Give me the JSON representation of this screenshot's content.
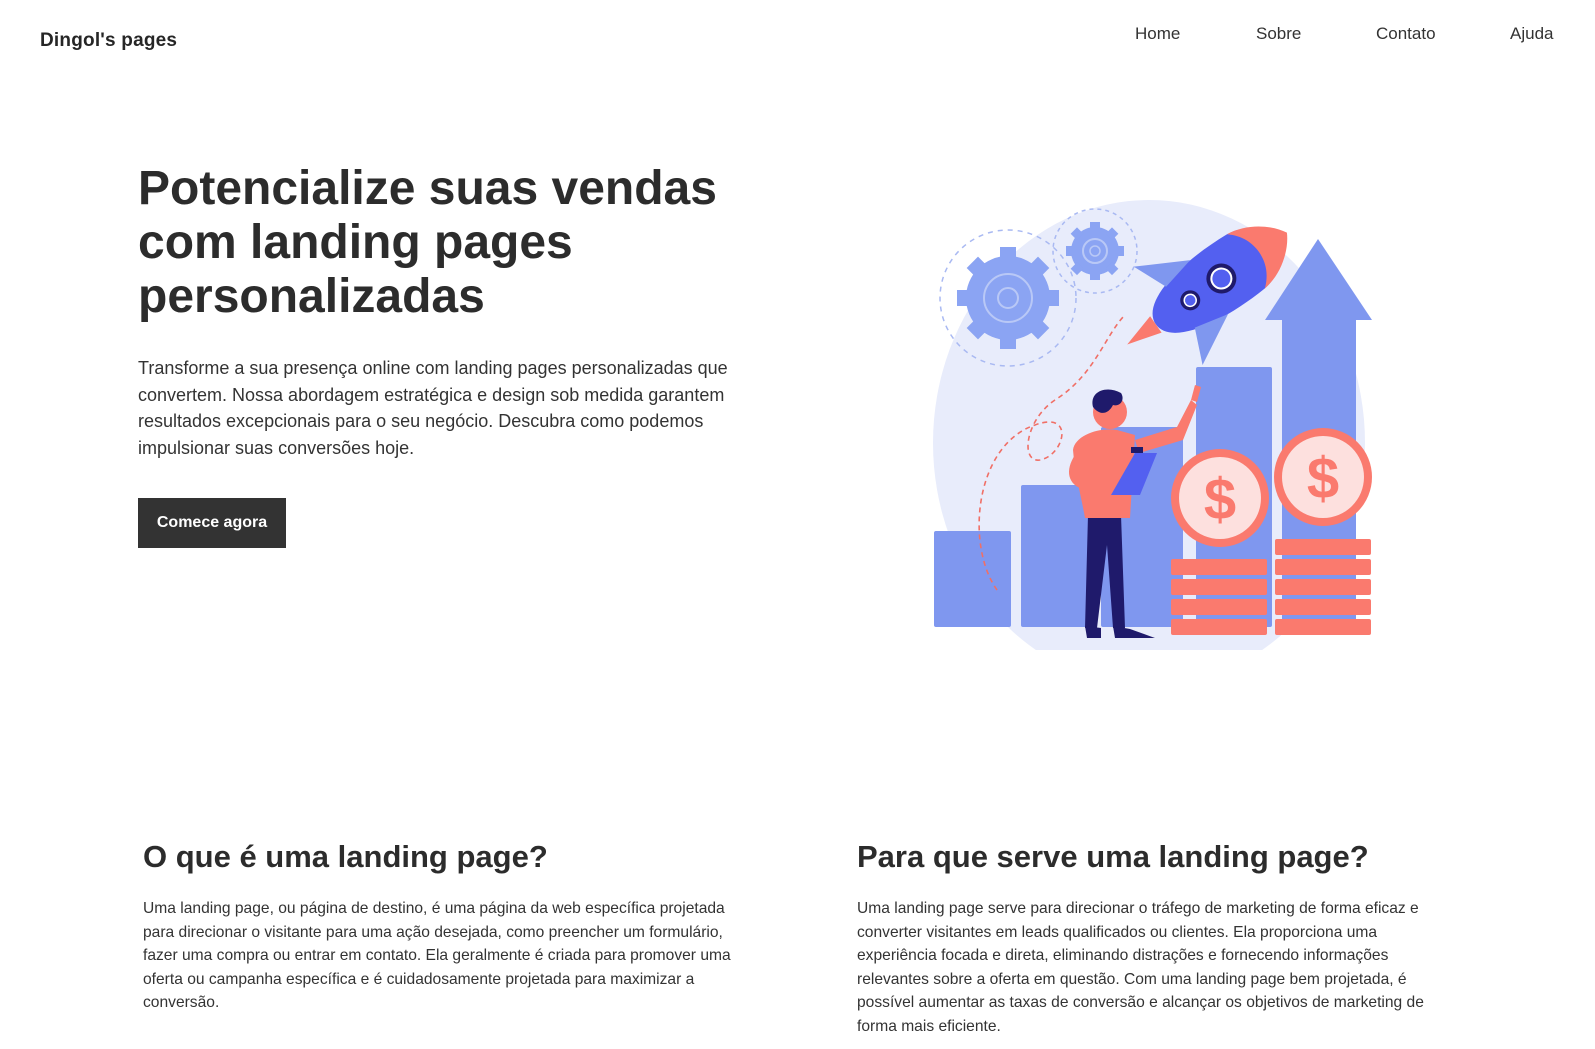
{
  "header": {
    "brand": "Dingol's pages",
    "nav": [
      "Home",
      "Sobre",
      "Contato",
      "Ajuda"
    ]
  },
  "hero": {
    "title": "Potencialize suas vendas com landing pages personalizadas",
    "text": "Transforme a sua presença online com landing pages personalizadas que convertem. Nossa abordagem estratégica e design sob medida garantem resultados excepcionais para o seu negócio. Descubra como podemos impulsionar suas conversões hoje.",
    "cta": "Comece agora",
    "illustration_icons": [
      "rocket-icon",
      "gear-icon",
      "dollar-coin-icon",
      "growth-arrow-icon",
      "person-clipboard-icon"
    ]
  },
  "sections": [
    {
      "title": "O que é uma landing page?",
      "text": "Uma landing page, ou página de destino, é uma página da web específica projetada para direcionar o visitante para uma ação desejada, como preencher um formulário, fazer uma compra ou entrar em contato. Ela geralmente é criada para promover uma oferta ou campanha específica e é cuidadosamente projetada para maximizar a conversão."
    },
    {
      "title": "Para que serve uma landing page?",
      "text": "Uma landing page serve para direcionar o tráfego de marketing de forma eficaz e converter visitantes em leads qualificados ou clientes. Ela proporciona uma experiência focada e direta, eliminando distrações e fornecendo informações relevantes sobre a oferta em questão. Com uma landing page bem projetada, é possível aumentar as taxas de conversão e alcançar os objetivos de marketing de forma mais eficiente."
    }
  ],
  "colors": {
    "text": "#2f2f2f",
    "button_bg": "#333333",
    "illustration_blue": "#7f97ef",
    "illustration_light": "#e8ecfb",
    "illustration_coral": "#fa7a6e",
    "illustration_navy": "#1f1a6b"
  }
}
